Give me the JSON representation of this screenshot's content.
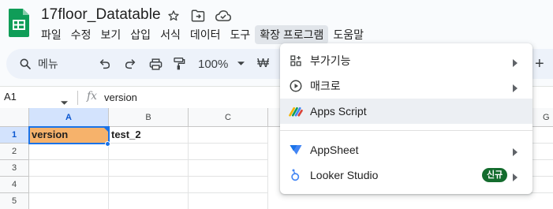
{
  "app": {
    "doc_title": "17floor_Datatable",
    "logo_icon": "sheets-logo-icon",
    "title_icons": [
      "star-icon",
      "move-to-folder-icon",
      "cloud-saved-icon"
    ]
  },
  "menubar": {
    "items": [
      {
        "label": "파일"
      },
      {
        "label": "수정"
      },
      {
        "label": "보기"
      },
      {
        "label": "삽입"
      },
      {
        "label": "서식"
      },
      {
        "label": "데이터"
      },
      {
        "label": "도구"
      },
      {
        "label": "확장 프로그램"
      },
      {
        "label": "도움말"
      }
    ],
    "active_index": 7
  },
  "toolbar": {
    "search_label": "메뉴",
    "zoom": "100%",
    "currency_symbol": "₩",
    "plus": "+"
  },
  "formula_bar": {
    "name_box": "A1",
    "fx_label": "fx",
    "value": "version"
  },
  "grid": {
    "columns": [
      "A",
      "B",
      "C",
      "G"
    ],
    "rows": [
      "1",
      "2",
      "3",
      "4",
      "5"
    ],
    "cells": {
      "A1": "version",
      "B1": "test_2"
    },
    "selected_cell_color": "#f6b26b",
    "selection_border_color": "#1a73e8"
  },
  "dropdown": {
    "items": [
      {
        "label": "부가기능",
        "icon": "add-ons-icon",
        "has_submenu": true
      },
      {
        "label": "매크로",
        "icon": "macro-play-icon",
        "has_submenu": true
      },
      {
        "label": "Apps Script",
        "icon": "apps-script-icon",
        "has_submenu": false,
        "highlighted": true
      },
      {
        "label": "AppSheet",
        "icon": "appsheet-icon",
        "has_submenu": true
      },
      {
        "label": "Looker Studio",
        "icon": "looker-studio-icon",
        "has_submenu": true,
        "badge": "신규"
      }
    ]
  },
  "colors": {
    "sheets_green": "#0f9d58",
    "toolbar_bg": "#edf2fa",
    "badge_green": "#146c2e"
  }
}
